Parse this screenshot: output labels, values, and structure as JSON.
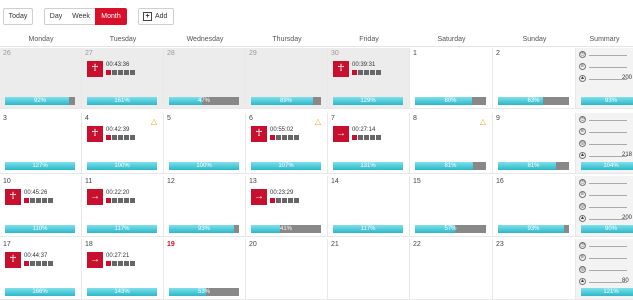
{
  "toolbar": {
    "today_label": "Today",
    "day_label": "Day",
    "week_label": "Week",
    "month_label": "Month",
    "add_label": "Add",
    "accent_color": "#d9102a"
  },
  "headers": [
    "Monday",
    "Tuesday",
    "Wednesday",
    "Thursday",
    "Friday",
    "Saturday",
    "Sunday",
    "Summary"
  ],
  "weeks": [
    {
      "days": [
        {
          "num": "26",
          "other": true,
          "progress_label": "92%",
          "progress": 0.92
        },
        {
          "num": "27",
          "other": true,
          "activity": {
            "icon": "weightlifting-icon",
            "time": "00:43:36",
            "squares": 1
          },
          "progress_label": "161%",
          "progress": 1.0
        },
        {
          "num": "28",
          "other": true,
          "progress_label": "47%",
          "progress": 0.47
        },
        {
          "num": "29",
          "other": true,
          "progress_label": "89%",
          "progress": 0.89
        },
        {
          "num": "30",
          "other": true,
          "activity": {
            "icon": "weightlifting-icon",
            "time": "00:39:31",
            "squares": 1
          },
          "progress_label": "129%",
          "progress": 1.0
        },
        {
          "num": "1",
          "progress_label": "80%",
          "progress": 0.8
        },
        {
          "num": "2",
          "progress_label": "63%",
          "progress": 0.63
        }
      ],
      "summary": [
        {
          "icon": "stopwatch-icon",
          "value": ""
        },
        {
          "icon": "fitness-icon",
          "value": ""
        },
        {
          "icon": "flame-icon",
          "value": "200"
        }
      ],
      "summary_progress_label": "93%",
      "summary_progress": 0.93
    },
    {
      "days": [
        {
          "num": "3",
          "progress_label": "127%",
          "progress": 1.0
        },
        {
          "num": "4",
          "warning": true,
          "activity": {
            "icon": "weightlifting-icon",
            "time": "00:42:39",
            "squares": 1
          },
          "progress_label": "100%",
          "progress": 1.0
        },
        {
          "num": "5",
          "progress_label": "100%",
          "progress": 1.0
        },
        {
          "num": "6",
          "warning": true,
          "activity": {
            "icon": "weightlifting-icon",
            "time": "00:55:02",
            "squares": 1
          },
          "progress_label": "107%",
          "progress": 1.0
        },
        {
          "num": "7",
          "activity": {
            "icon": "running-icon",
            "time": "00:27:14",
            "squares": 1
          },
          "progress_label": "131%",
          "progress": 1.0
        },
        {
          "num": "8",
          "warning": true,
          "progress_label": "81%",
          "progress": 0.81
        },
        {
          "num": "9",
          "progress_label": "81%",
          "progress": 0.81
        }
      ],
      "summary": [
        {
          "icon": "stopwatch-icon",
          "value": ""
        },
        {
          "icon": "fitness-icon",
          "value": ""
        },
        {
          "icon": "distance-icon",
          "value": ""
        },
        {
          "icon": "flame-icon",
          "value": "218"
        }
      ],
      "summary_progress_label": "104%",
      "summary_progress": 1.0
    },
    {
      "days": [
        {
          "num": "10",
          "activity": {
            "icon": "weightlifting-icon",
            "time": "00:45:26",
            "squares": 1
          },
          "progress_label": "110%",
          "progress": 1.0
        },
        {
          "num": "11",
          "activity": {
            "icon": "running-icon",
            "time": "00:22:20",
            "squares": 1
          },
          "progress_label": "117%",
          "progress": 1.0
        },
        {
          "num": "12",
          "progress_label": "93%",
          "progress": 0.93
        },
        {
          "num": "13",
          "activity": {
            "icon": "running-icon",
            "time": "00:23:29",
            "squares": 1
          },
          "progress_label": "41%",
          "progress": 0.41
        },
        {
          "num": "14",
          "progress_label": "117%",
          "progress": 1.0
        },
        {
          "num": "15",
          "progress_label": "57%",
          "progress": 0.57
        },
        {
          "num": "16",
          "progress_label": "93%",
          "progress": 0.93
        }
      ],
      "summary": [
        {
          "icon": "stopwatch-icon",
          "value": ""
        },
        {
          "icon": "fitness-icon",
          "value": ""
        },
        {
          "icon": "distance-icon",
          "value": ""
        },
        {
          "icon": "flame-icon",
          "value": "200"
        }
      ],
      "summary_progress_label": "90%",
      "summary_progress": 0.9
    },
    {
      "days": [
        {
          "num": "17",
          "activity": {
            "icon": "weightlifting-icon",
            "time": "00:44:37",
            "squares": 1
          },
          "progress_label": "166%",
          "progress": 1.0
        },
        {
          "num": "18",
          "activity": {
            "icon": "running-icon",
            "time": "00:27:21",
            "squares": 1
          },
          "progress_label": "143%",
          "progress": 1.0
        },
        {
          "num": "19",
          "today": true,
          "progress_label": "53%",
          "progress": 0.53
        },
        {
          "num": "20"
        },
        {
          "num": "21"
        },
        {
          "num": "22"
        },
        {
          "num": "23"
        }
      ],
      "summary": [
        {
          "icon": "stopwatch-icon",
          "value": ""
        },
        {
          "icon": "fitness-icon",
          "value": ""
        },
        {
          "icon": "distance-icon",
          "value": ""
        },
        {
          "icon": "flame-icon",
          "value": "80"
        }
      ],
      "summary_progress_label": "121%",
      "summary_progress": 1.0
    }
  ]
}
